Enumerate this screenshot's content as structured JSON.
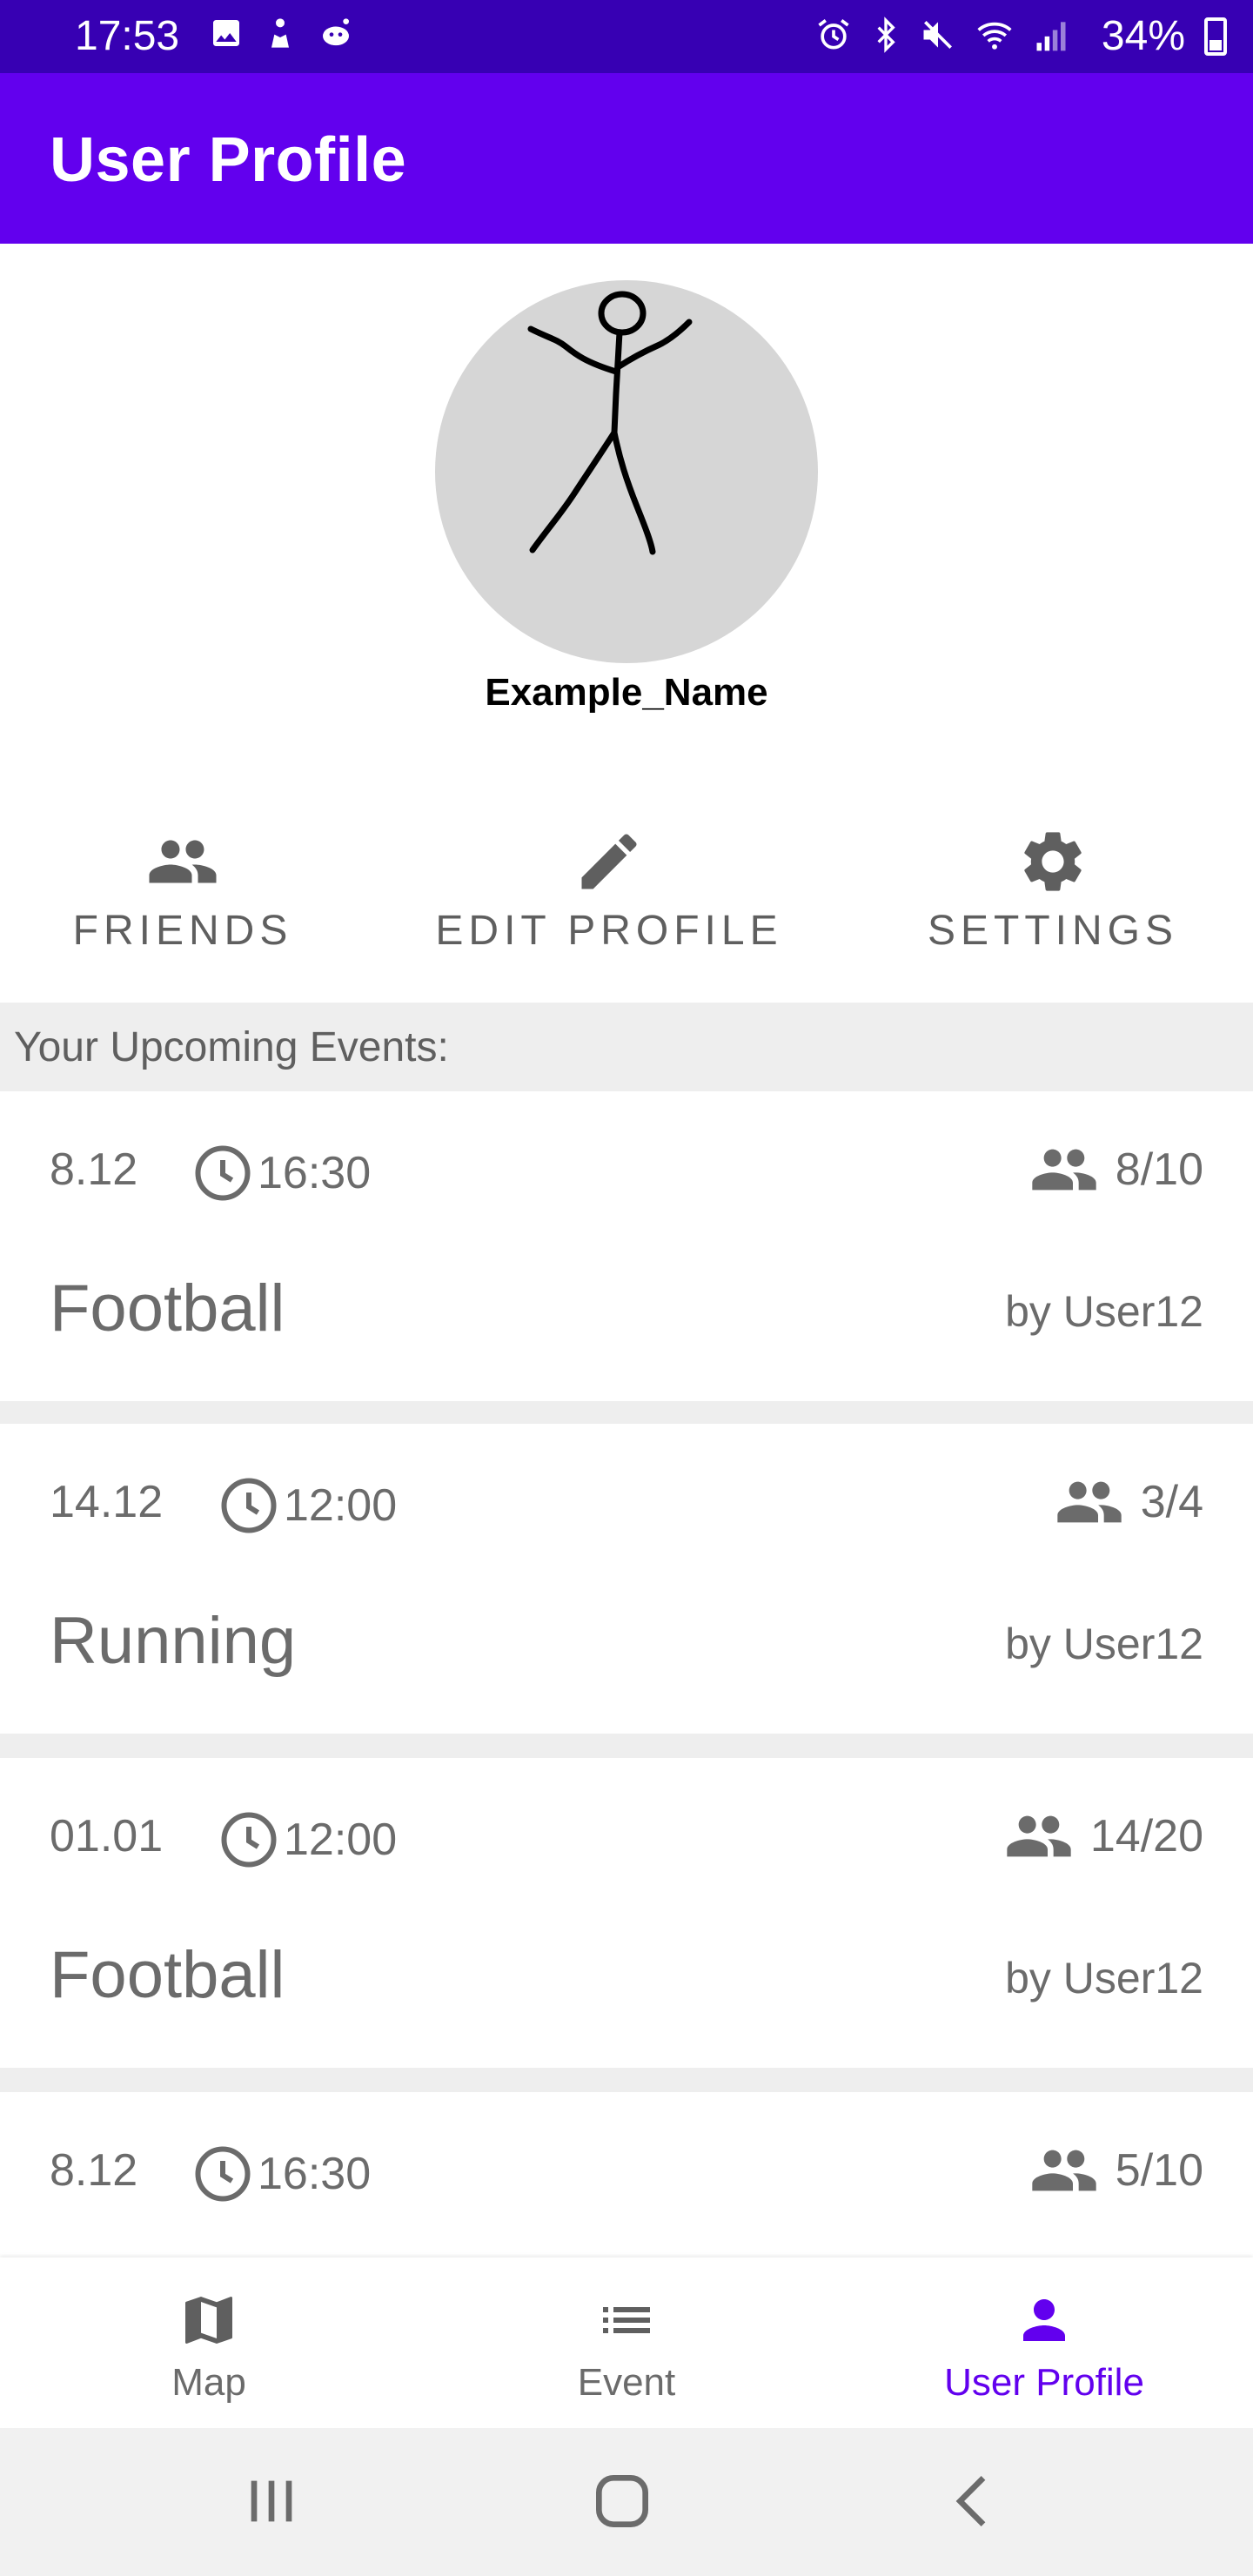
{
  "status_bar": {
    "time": "17:53",
    "battery": "34%",
    "left_icons": [
      "gallery-icon",
      "notification-figure-icon",
      "reddit-icon"
    ],
    "right_icons": [
      "alarm-icon",
      "bluetooth-icon",
      "mute-icon",
      "wifi-icon",
      "signal-icon",
      "battery-charging-icon"
    ]
  },
  "app_bar": {
    "title": "User Profile"
  },
  "profile": {
    "name": "Example_Name"
  },
  "actions": {
    "friends": "FRIENDS",
    "edit": "EDIT PROFILE",
    "settings": "SETTINGS"
  },
  "section": {
    "title": "Your Upcoming Events:"
  },
  "events": [
    {
      "date": "8.12",
      "time": "16:30",
      "participants": "8/10",
      "sport": "Football",
      "owner": "by User12"
    },
    {
      "date": "14.12",
      "time": "12:00",
      "participants": "3/4",
      "sport": "Running",
      "owner": "by User12"
    },
    {
      "date": "01.01",
      "time": "12:00",
      "participants": "14/20",
      "sport": "Football",
      "owner": "by User12"
    },
    {
      "date": "8.12",
      "time": "16:30",
      "participants": "5/10",
      "sport": "",
      "owner": ""
    }
  ],
  "bottom_nav": {
    "map": "Map",
    "event": "Event",
    "profile": "User Profile",
    "active": "profile"
  },
  "colors": {
    "status_bar": "#3700b3",
    "primary": "#6200ee",
    "icon_gray": "#5f5f5f",
    "text_gray": "#6b6b6b",
    "divider": "#eeeeee",
    "avatar_bg": "#d6d6d6"
  }
}
